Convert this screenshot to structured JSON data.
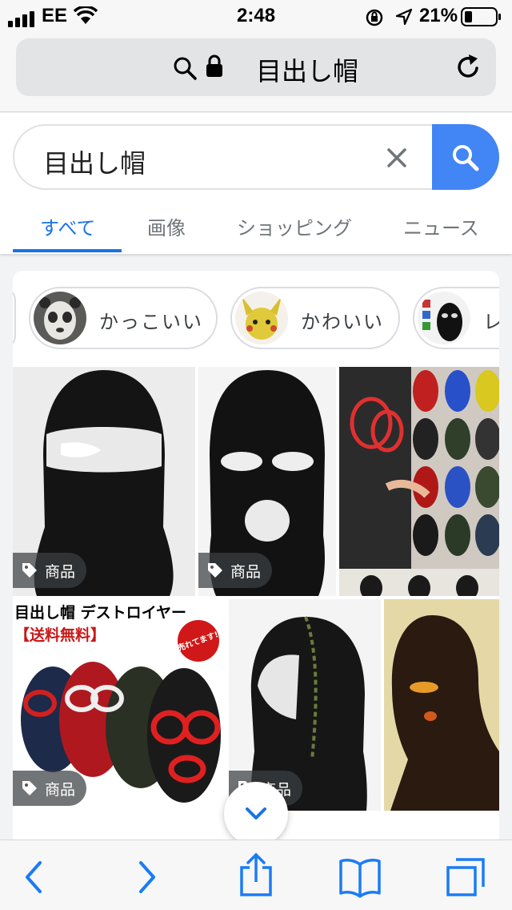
{
  "status_bar": {
    "carrier": "EE",
    "time": "2:48",
    "battery": "21%"
  },
  "address_bar": {
    "url_text": "目出し帽"
  },
  "search": {
    "query": "目出し帽"
  },
  "tabs": [
    {
      "label": "すべて",
      "active": true
    },
    {
      "label": "画像",
      "active": false
    },
    {
      "label": "ショッピング",
      "active": false
    },
    {
      "label": "ニュース",
      "active": false
    }
  ],
  "chips": [
    {
      "label": "かっこいい"
    },
    {
      "label": "かわいい"
    },
    {
      "label": "レ"
    }
  ],
  "images": {
    "badge_label": "商品",
    "promo_line1": "目出し帽 デストロイヤー",
    "promo_line2": "【送料無料】",
    "promo_sticker": "売れてます!"
  },
  "colors": {
    "accent": "#1a73e8",
    "search_button": "#4285f4",
    "safari_blue": "#1a7cf5"
  },
  "icons": [
    "signal-icon",
    "wifi-icon",
    "search-icon",
    "lock-icon",
    "reload-icon",
    "close-icon",
    "tag-icon",
    "chevron-down-icon",
    "back-icon",
    "forward-icon",
    "share-icon",
    "bookmarks-icon",
    "tabs-icon"
  ]
}
